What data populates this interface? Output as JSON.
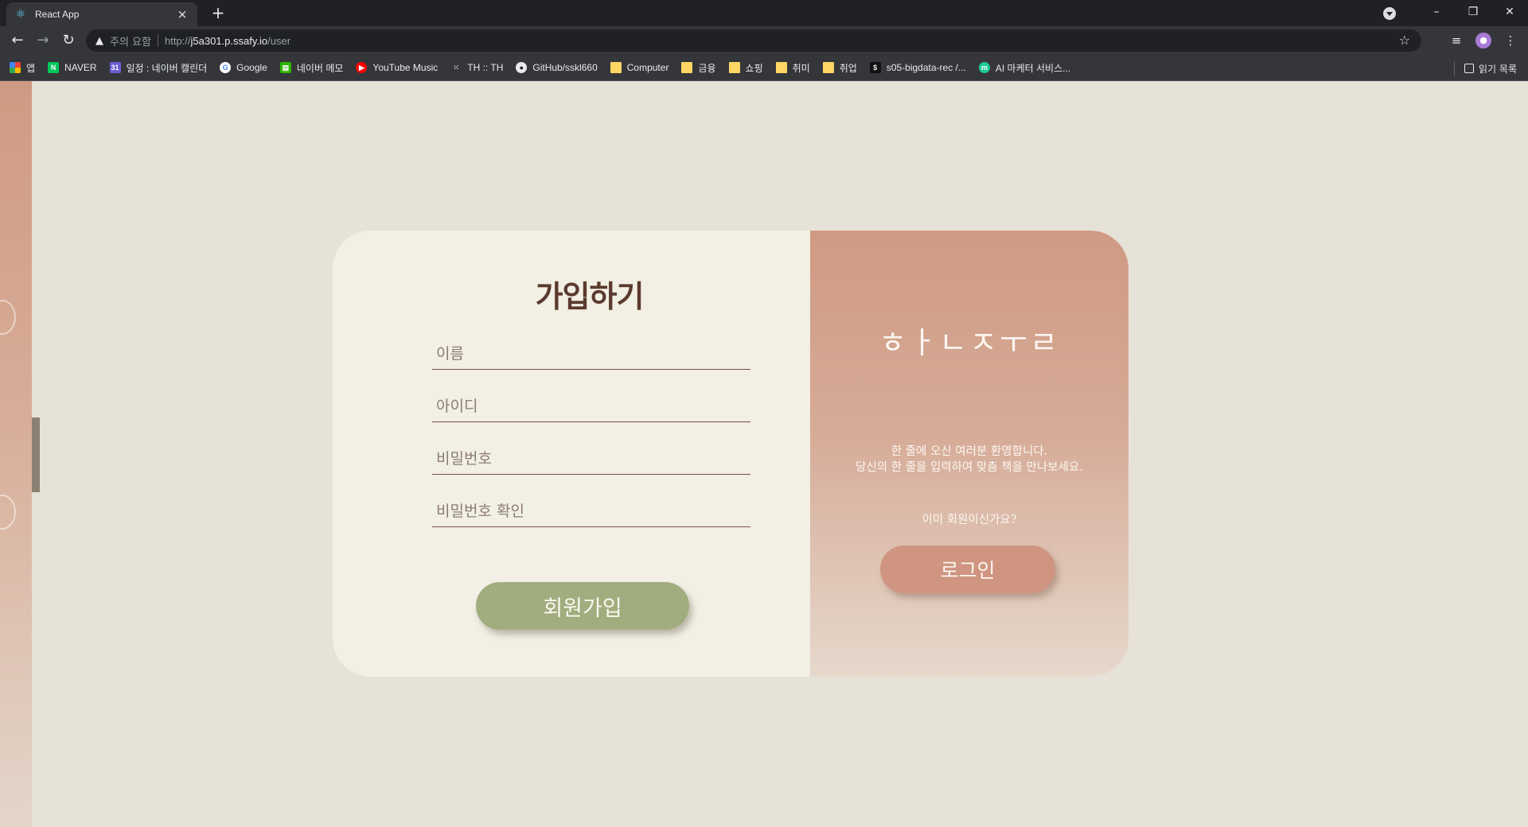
{
  "browser": {
    "tab_title": "React App",
    "tab_close": "×",
    "new_tab": "+",
    "win_minimize": "–",
    "win_restore": "❐",
    "win_close": "✕",
    "back": "←",
    "forward": "→",
    "reload": "↻",
    "security_warning": "주의 요함",
    "url_scheme": "http://",
    "url_host": "j5a301.p.ssafy.io",
    "url_path": "/user",
    "star": "☆"
  },
  "bookmarks": [
    {
      "label": "앱",
      "icon": "apps-icon"
    },
    {
      "label": "NAVER",
      "icon": "naver-icon"
    },
    {
      "label": "일정 : 네이버 캘린더",
      "icon": "calendar-icon"
    },
    {
      "label": "Google",
      "icon": "google-icon"
    },
    {
      "label": "네이버 메모",
      "icon": "memo-icon"
    },
    {
      "label": "YouTube Music",
      "icon": "youtube-music-icon"
    },
    {
      "label": "TH :: TH",
      "icon": "th-icon"
    },
    {
      "label": "GitHub/sskl660",
      "icon": "github-icon"
    },
    {
      "label": "Computer",
      "icon": "folder-icon"
    },
    {
      "label": "금융",
      "icon": "folder-icon"
    },
    {
      "label": "쇼핑",
      "icon": "folder-icon"
    },
    {
      "label": "취미",
      "icon": "folder-icon"
    },
    {
      "label": "취업",
      "icon": "folder-icon"
    },
    {
      "label": "s05-bigdata-rec /...",
      "icon": "terminal-icon"
    },
    {
      "label": "AI 마케터 서비스...",
      "icon": "m-icon"
    }
  ],
  "reading_list": "읽기 목록",
  "signup": {
    "title": "가입하기",
    "name_placeholder": "이름",
    "id_placeholder": "아이디",
    "password_placeholder": "비밀번호",
    "password_confirm_placeholder": "비밀번호 확인",
    "submit_label": "회원가입"
  },
  "login": {
    "logo": "ㅎㅏㄴㅈㅜㄹ",
    "welcome_line1": "한 줄에 오신 여러분 환영합니다.",
    "welcome_line2": "당신의 한 줄을 입력하여 맞춤 책을 만나보세요.",
    "already_member": "이미 회원이신가요?",
    "login_label": "로그인"
  },
  "colors": {
    "page_bg": "#e7e2d7",
    "form_bg": "#f2efe5",
    "title_brown": "#5b3a2e",
    "signup_button": "#a1ad7e",
    "login_button": "#cf9580",
    "gradient_top": "#cf9a83",
    "gradient_bottom": "#e6d8cc"
  }
}
